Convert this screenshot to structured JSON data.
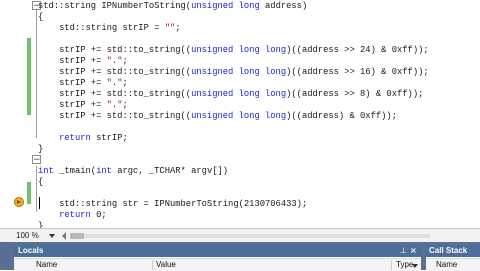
{
  "editor": {
    "lines": [
      [
        {
          "t": "std::string IPNumberToString(",
          "c": ""
        },
        {
          "t": "unsigned long",
          "c": "kw"
        },
        {
          "t": " address)",
          "c": ""
        }
      ],
      [
        {
          "t": "{",
          "c": ""
        }
      ],
      [
        {
          "t": "    std::string strIP = ",
          "c": ""
        },
        {
          "t": "\"\"",
          "c": "str"
        },
        {
          "t": ";",
          "c": ""
        }
      ],
      [],
      [
        {
          "t": "    strIP += std::to_string((",
          "c": ""
        },
        {
          "t": "unsigned long long",
          "c": "kw"
        },
        {
          "t": ")((address >> 24) & 0xff));",
          "c": ""
        }
      ],
      [
        {
          "t": "    strIP += ",
          "c": ""
        },
        {
          "t": "\".\"",
          "c": "str"
        },
        {
          "t": ";",
          "c": ""
        }
      ],
      [
        {
          "t": "    strIP += std::to_string((",
          "c": ""
        },
        {
          "t": "unsigned long long",
          "c": "kw"
        },
        {
          "t": ")((address >> 16) & 0xff));",
          "c": ""
        }
      ],
      [
        {
          "t": "    strIP += ",
          "c": ""
        },
        {
          "t": "\".\"",
          "c": "str"
        },
        {
          "t": ";",
          "c": ""
        }
      ],
      [
        {
          "t": "    strIP += std::to_string((",
          "c": ""
        },
        {
          "t": "unsigned long long",
          "c": "kw"
        },
        {
          "t": ")((address >> 8) & 0xff));",
          "c": ""
        }
      ],
      [
        {
          "t": "    strIP += ",
          "c": ""
        },
        {
          "t": "\".\"",
          "c": "str"
        },
        {
          "t": ";",
          "c": ""
        }
      ],
      [
        {
          "t": "    strIP += std::to_string((",
          "c": ""
        },
        {
          "t": "unsigned long long",
          "c": "kw"
        },
        {
          "t": ")((address) & 0xff));",
          "c": ""
        }
      ],
      [],
      [
        {
          "t": "    ",
          "c": ""
        },
        {
          "t": "return",
          "c": "kw"
        },
        {
          "t": " strIP;",
          "c": ""
        }
      ],
      [
        {
          "t": "}",
          "c": ""
        }
      ],
      [],
      [
        {
          "t": "int",
          "c": "kw"
        },
        {
          "t": " _tmain(",
          "c": ""
        },
        {
          "t": "int",
          "c": "kw"
        },
        {
          "t": " argc, _TCHAR* argv[])",
          "c": ""
        }
      ],
      [
        {
          "t": "{",
          "c": ""
        }
      ],
      [],
      [
        {
          "t": "    std::string str = IPNumberToString(2130706433);",
          "c": ""
        }
      ],
      [
        {
          "t": "    ",
          "c": ""
        },
        {
          "t": "return",
          "c": "kw"
        },
        {
          "t": " 0;",
          "c": ""
        }
      ],
      [
        {
          "t": "}",
          "c": ""
        }
      ]
    ]
  },
  "status_bar": {
    "zoom": "100 %"
  },
  "locals_panel": {
    "title": "Locals",
    "columns": [
      "Name",
      "Value",
      "Type"
    ]
  },
  "callstack_panel": {
    "title": "Call Stack",
    "columns": [
      "Name"
    ]
  },
  "colors": {
    "keyword": "#1f1fd6",
    "string": "#a31515",
    "change_bar": "#6fc26a",
    "tool_window_title": "#4d6e9b"
  },
  "icons": [
    "collapse-minus-icon",
    "current-statement-arrow-icon",
    "pin-icon",
    "close-icon",
    "dropdown-arrow-icon"
  ]
}
